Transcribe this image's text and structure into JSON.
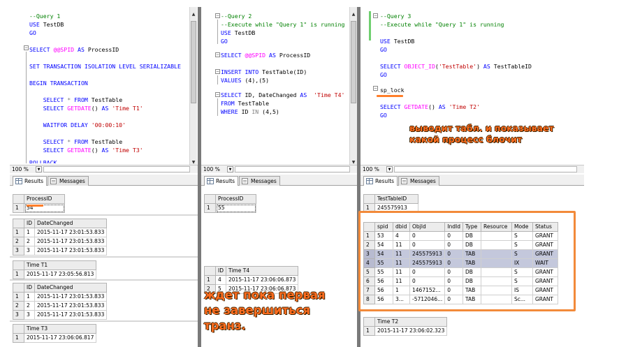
{
  "panels": [
    {
      "code": [
        "--Query 1",
        "USE TestDB",
        "GO",
        "",
        "SELECT @@SPID AS ProcessID",
        "",
        "SET TRANSACTION ISOLATION LEVEL SERIALIZABLE",
        "",
        "BEGIN TRANSACTION",
        "",
        "    SELECT * FROM TestTable",
        "    SELECT GETDATE() AS 'Time T1'",
        "",
        "    WAITFOR DELAY '00:00:10'",
        "",
        "    SELECT * FROM TestTable",
        "    SELECT GETDATE() AS 'Time T3'",
        "",
        "ROLLBACK"
      ],
      "zoom": "100 %",
      "tabs": {
        "results": "Results",
        "messages": "Messages"
      },
      "grids": [
        {
          "headers": [
            "ProcessID"
          ],
          "rows": [
            [
              "1",
              "54"
            ]
          ]
        },
        {
          "headers": [
            "ID",
            "DateChanged"
          ],
          "rows": [
            [
              "1",
              "1",
              "2015-11-17 23:01:53.833"
            ],
            [
              "2",
              "2",
              "2015-11-17 23:01:53.833"
            ],
            [
              "3",
              "3",
              "2015-11-17 23:01:53.833"
            ]
          ]
        },
        {
          "headers": [
            "Time T1"
          ],
          "rows": [
            [
              "1",
              "2015-11-17 23:05:56.813"
            ]
          ]
        },
        {
          "headers": [
            "ID",
            "DateChanged"
          ],
          "rows": [
            [
              "1",
              "1",
              "2015-11-17 23:01:53.833"
            ],
            [
              "2",
              "2",
              "2015-11-17 23:01:53.833"
            ],
            [
              "3",
              "3",
              "2015-11-17 23:01:53.833"
            ]
          ]
        },
        {
          "headers": [
            "Time T3"
          ],
          "rows": [
            [
              "1",
              "2015-11-17 23:06:06.817"
            ]
          ]
        }
      ]
    },
    {
      "code": [
        "--Query 2",
        "--Execute while \"Query 1\" is running",
        "USE TestDB",
        "GO",
        "",
        "SELECT @@SPID AS ProcessID",
        "",
        "INSERT INTO TestTable(ID)",
        "VALUES (4),(5)",
        "",
        "SELECT ID, DateChanged AS  'Time T4'",
        "FROM TestTable",
        "WHERE ID IN (4,5)"
      ],
      "zoom": "100 %",
      "tabs": {
        "results": "Results",
        "messages": "Messages"
      },
      "grids": [
        {
          "headers": [
            "ProcessID"
          ],
          "rows": [
            [
              "1",
              "55"
            ]
          ]
        },
        {
          "headers": [
            "ID",
            "Time T4"
          ],
          "rows": [
            [
              "1",
              "4",
              "2015-11-17 23:06:06.873"
            ],
            [
              "2",
              "5",
              "2015-11-17 23:06:06.873"
            ]
          ]
        }
      ]
    },
    {
      "code": [
        "--Query 3",
        "--Execute while \"Query 1\" is running",
        "",
        "USE TestDB",
        "GO",
        "",
        "SELECT OBJECT_ID('TestTable') AS TestTableID",
        "GO",
        "",
        "sp_lock",
        "",
        "SELECT GETDATE() AS 'Time T2'",
        "GO"
      ],
      "zoom": "100 %",
      "tabs": {
        "results": "Results",
        "messages": "Messages"
      },
      "grids": [
        {
          "headers": [
            "TestTableID"
          ],
          "rows": [
            [
              "1",
              "245575913"
            ]
          ]
        },
        {
          "headers": [
            "spid",
            "dbid",
            "ObjId",
            "IndId",
            "Type",
            "Resource",
            "Mode",
            "Status"
          ],
          "rows": [
            [
              "1",
              "53",
              "4",
              "0",
              "0",
              "DB",
              "",
              "S",
              "GRANT"
            ],
            [
              "2",
              "54",
              "11",
              "0",
              "0",
              "DB",
              "",
              "S",
              "GRANT"
            ],
            [
              "3",
              "54",
              "11",
              "245575913",
              "0",
              "TAB",
              "",
              "S",
              "GRANT"
            ],
            [
              "4",
              "55",
              "11",
              "245575913",
              "0",
              "TAB",
              "",
              "IX",
              "WAIT"
            ],
            [
              "5",
              "55",
              "11",
              "0",
              "0",
              "DB",
              "",
              "S",
              "GRANT"
            ],
            [
              "6",
              "56",
              "11",
              "0",
              "0",
              "DB",
              "",
              "S",
              "GRANT"
            ],
            [
              "7",
              "56",
              "1",
              "1467152...",
              "0",
              "TAB",
              "",
              "IS",
              "GRANT"
            ],
            [
              "8",
              "56",
              "3...",
              "-5712046...",
              "0",
              "TAB",
              "",
              "Sc...",
              "GRANT"
            ]
          ]
        },
        {
          "headers": [
            "Time T2"
          ],
          "rows": [
            [
              "1",
              "2015-11-17 23:06:02.323"
            ]
          ]
        }
      ]
    }
  ],
  "annotations": {
    "lock_note": [
      "выводит табл. и показывает",
      "какой процесс блочит"
    ],
    "wait_note": [
      "ждет пока первая",
      "не завершиться",
      "транз."
    ]
  },
  "colors": {
    "annotation": "#ff6d1f",
    "keyword": "#0000ff",
    "string": "#c00000",
    "comment": "#008000",
    "system_var": "#ff00ff"
  }
}
